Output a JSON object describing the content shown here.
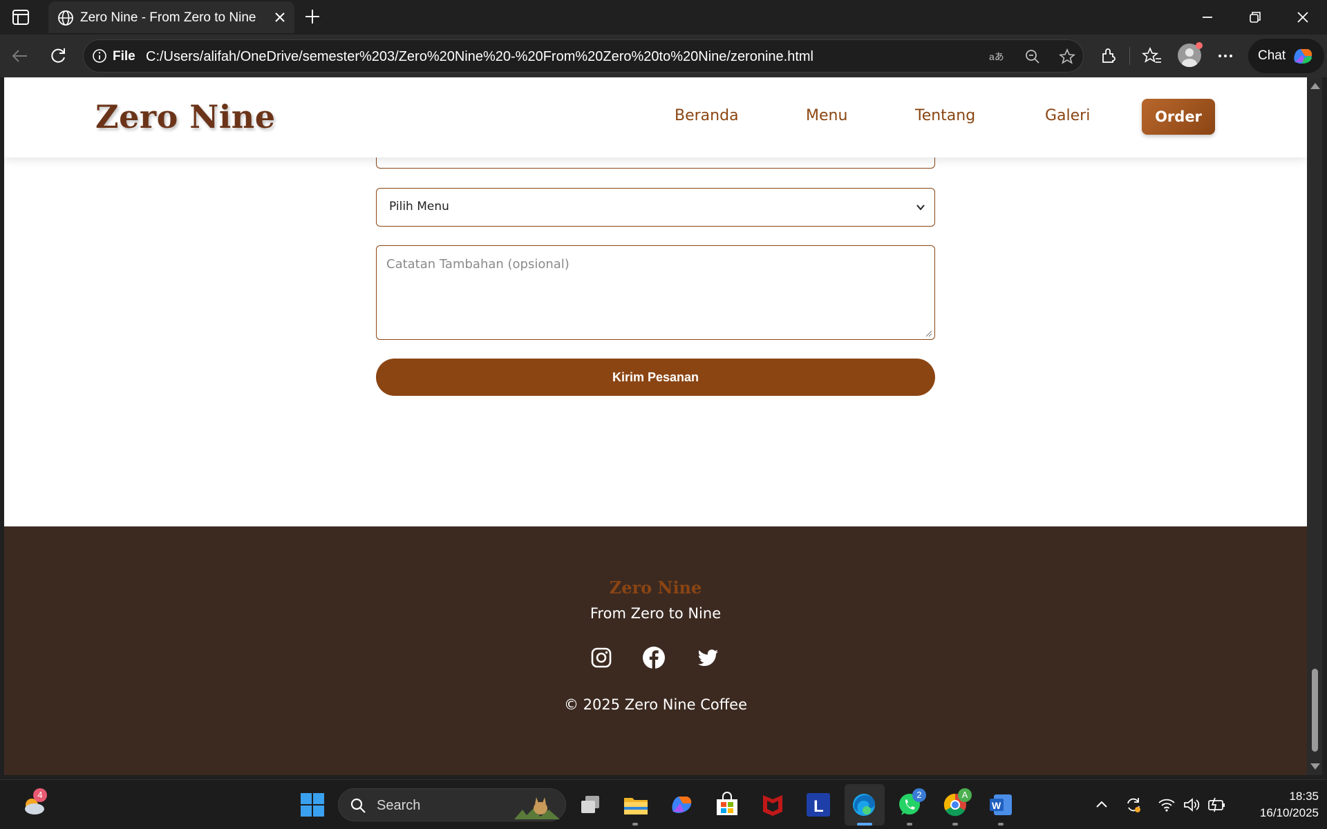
{
  "browser": {
    "tab_title": "Zero Nine - From Zero to Nine",
    "address_prefix": "File",
    "url": "C:/Users/alifah/OneDrive/semester%203/Zero%20Nine%20-%20From%20Zero%20to%20Nine/zeronine.html",
    "chat_label": "Chat"
  },
  "site": {
    "logo": "Zero Nine",
    "nav": {
      "beranda": "Beranda",
      "menu": "Menu",
      "tentang": "Tentang",
      "galeri": "Galeri",
      "order": "Order"
    },
    "form": {
      "menu_select_value": "Pilih Menu",
      "notes_placeholder": "Catatan Tambahan (opsional)",
      "submit_label": "Kirim Pesanan"
    },
    "footer": {
      "brand": "Zero Nine",
      "tagline": "From Zero to Nine",
      "copyright": "© 2025 Zero Nine Coffee",
      "social": [
        "instagram-icon",
        "facebook-icon",
        "twitter-icon"
      ]
    },
    "colors": {
      "brand_brown": "#8b4513",
      "logo_brown": "#6b3419",
      "footer_bg": "#3c2a21"
    }
  },
  "taskbar": {
    "search_label": "Search",
    "weather_badge": "4",
    "whatsapp_badge": "2",
    "chrome_badge": "A",
    "time": "18:35",
    "date": "16/10/2025"
  }
}
